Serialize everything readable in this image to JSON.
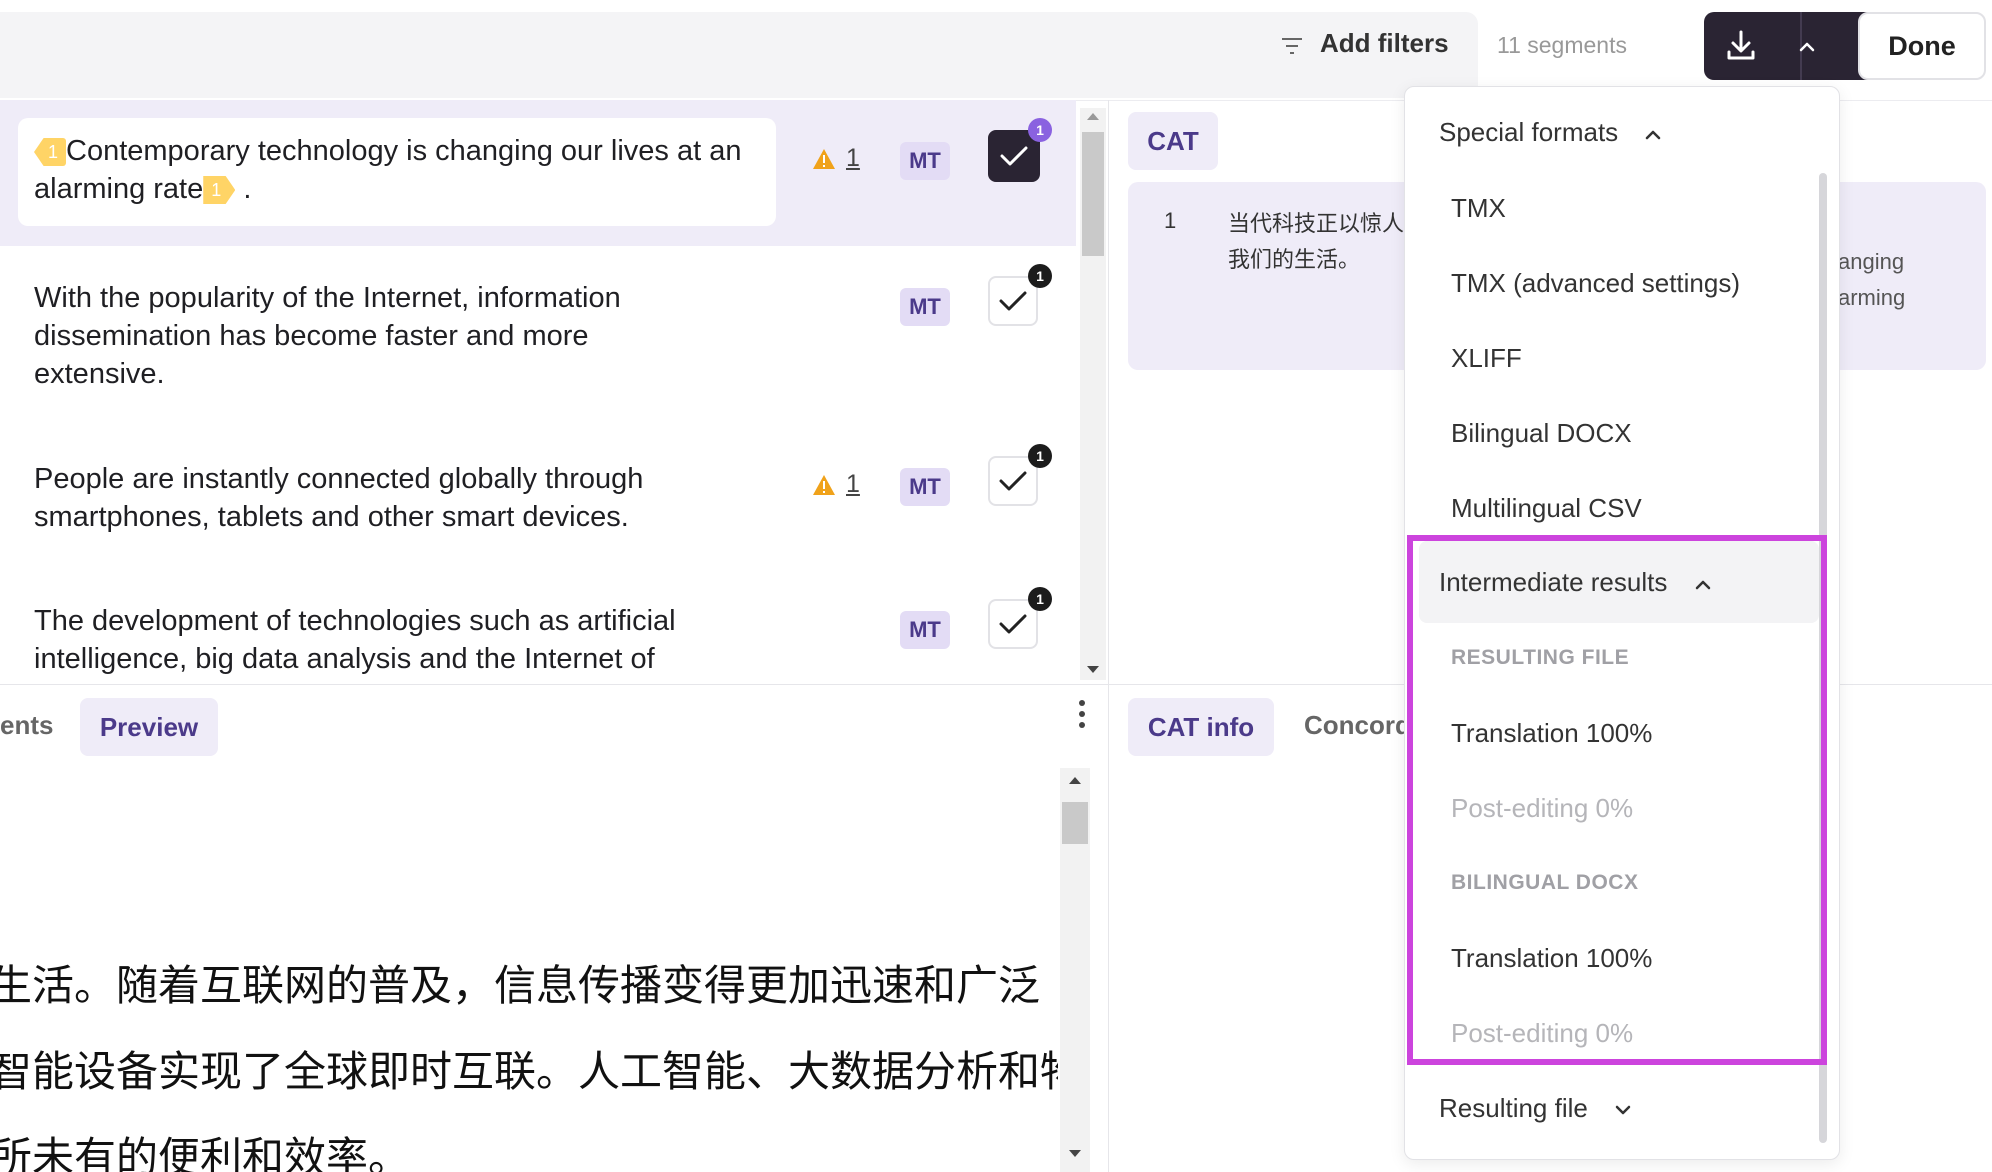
{
  "toolbar": {
    "filter_icon": "filter-lines-icon",
    "add_filters_label": "Add filters",
    "segment_count": "11 segments",
    "download_icon": "download-icon",
    "chevron_icon": "chevron-up-icon",
    "done_label": "Done"
  },
  "segments": [
    {
      "tag_start": "1",
      "text": "Contemporary technology is changing our lives at an alarming rate",
      "tag_end": "1",
      "text_after": " .",
      "warnings": "1",
      "badge": "MT",
      "confirmed": true,
      "count": "1"
    },
    {
      "text": "With the popularity of the Internet, information dissemination has become faster and more extensive.",
      "warnings": "",
      "badge": "MT",
      "confirmed": false,
      "count": "1"
    },
    {
      "text": "People are instantly connected globally through smartphones, tablets and other smart devices.",
      "warnings": "1",
      "badge": "MT",
      "confirmed": false,
      "count": "1"
    },
    {
      "text": "The development of technologies such as artificial intelligence, big data analysis and the Internet of",
      "warnings": "",
      "badge": "MT",
      "confirmed": false,
      "count": "1"
    }
  ],
  "lower_left": {
    "tab_partial": "ents",
    "tab_preview": "Preview",
    "more_icon": "vertical-ellipsis-icon",
    "preview_lines": [
      "生活。随着互联网的普及，信息传播变得更加迅速和广泛",
      "智能设备实现了全球即时互联。人工智能、大数据分析和物",
      "所未有的便利和效率。"
    ]
  },
  "right_panel": {
    "cat_tab": "CAT",
    "cat_row_number": "1",
    "cat_row_source": "当代科技正以惊人",
    "cat_row_source_2": "我们的生活。",
    "cat_row_target_1": "anging",
    "cat_row_target_2": "arming",
    "cat_info_tab": "CAT info",
    "concordance_tab": "Concord"
  },
  "dropdown": {
    "special_formats": "Special formats",
    "items_special": [
      "TMX",
      "TMX (advanced settings)",
      "XLIFF",
      "Bilingual DOCX",
      "Multilingual CSV"
    ],
    "intermediate_results": "Intermediate results",
    "caption_resulting_file": "RESULTING FILE",
    "resulting_translation": "Translation 100%",
    "resulting_post_editing": "Post-editing 0%",
    "caption_bilingual_docx": "BILINGUAL DOCX",
    "bilingual_translation": "Translation 100%",
    "bilingual_post_editing": "Post-editing 0%",
    "resulting_file": "Resulting file"
  },
  "colors": {
    "accent_purple": "#4b3a8a",
    "dark_button": "#2a2433",
    "highlight": "#cc44dd",
    "warning": "#e68a00",
    "tag_yellow": "#ffd466"
  }
}
